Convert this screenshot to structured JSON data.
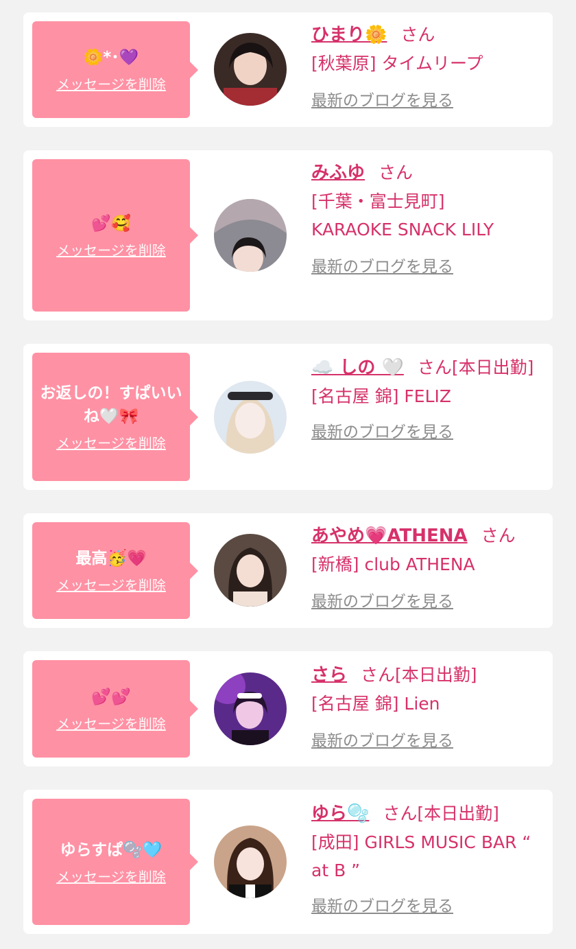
{
  "honorific": "さん",
  "delete_label": "メッセージを削除",
  "blog_label": "最新のブログを見る",
  "colors": {
    "bubble": "#ff91a4",
    "accent": "#d6316a",
    "link_gray": "#8c8c8c",
    "background": "#f2f2f2"
  },
  "items": [
    {
      "message": "🌼*･💜",
      "name": "ひまり🌼",
      "tag": "",
      "shop": "[秋葉原] タイムリープ",
      "avatar_icon": "avatar-photo"
    },
    {
      "message": "💕🥰",
      "name": "みふゆ",
      "tag": "",
      "shop": "[千葉・富士見町] KARAOKE SNACK LILY",
      "avatar_icon": "avatar-photo"
    },
    {
      "message": "お返しの！すぱいいね🤍🎀",
      "name": "☁️ しの 🤍",
      "tag": "[本日出勤]",
      "shop": "[名古屋 錦] FELIZ",
      "avatar_icon": "avatar-photo"
    },
    {
      "message": "最高🥳💗",
      "name": "あやめ💗ATHENA",
      "tag": "",
      "shop": "[新橋] club ATHENA",
      "avatar_icon": "avatar-photo"
    },
    {
      "message": "💕💕",
      "name": "さら",
      "tag": "[本日出勤]",
      "shop": "[名古屋 錦] Lien",
      "avatar_icon": "avatar-photo"
    },
    {
      "message": "ゆらすぱ🫧🩵",
      "name": "ゆら🫧",
      "tag": "[本日出勤]",
      "shop": "[成田] GIRLS MUSIC BAR “ at B ”",
      "avatar_icon": "avatar-photo"
    }
  ]
}
